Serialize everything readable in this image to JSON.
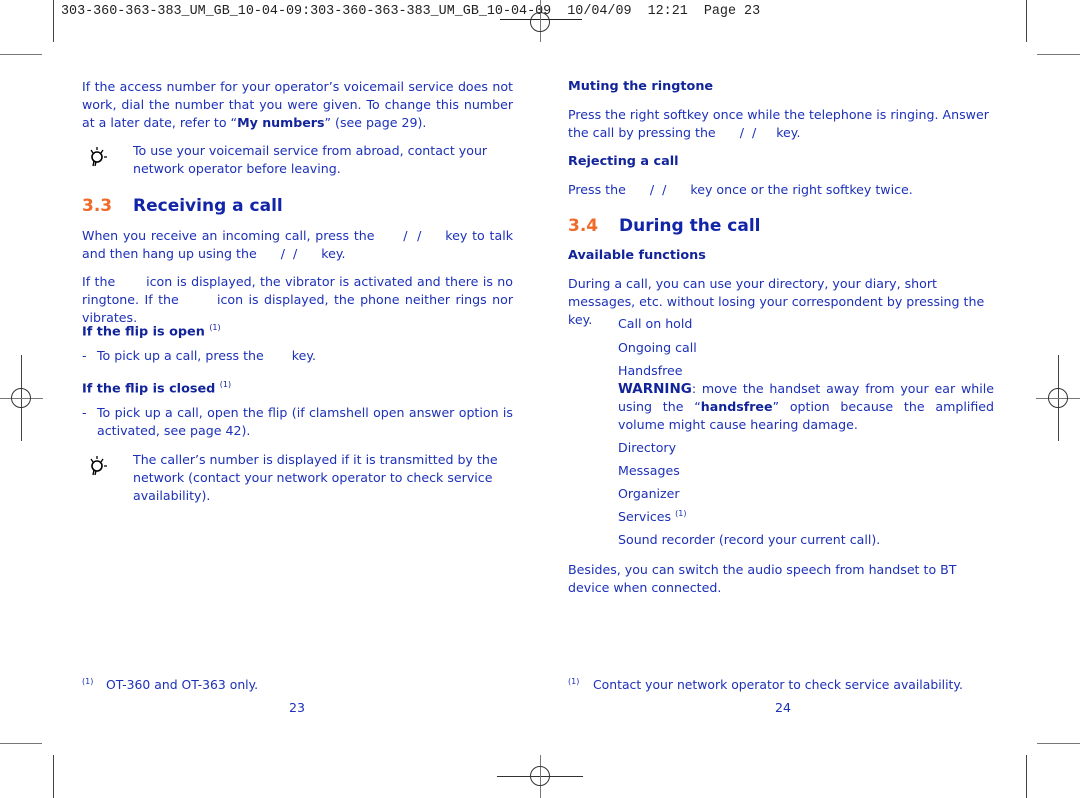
{
  "print_header": {
    "text": "303-360-363-383_UM_GB_10-04-09:303-360-363-383_UM_GB_10-04-09  10/04/09  12:21  Page 23"
  },
  "left_page": {
    "intro": {
      "part1": "If the access number for your operator’s voicemail service does not work, dial the number that you were given. To change this number at a later date, refer to “",
      "bold": "My numbers",
      "part2": "” (see page 29)."
    },
    "tip1": "To use your voicemail service from abroad, contact your network operator before leaving.",
    "section": {
      "number": "3.3",
      "title": "Receiving a call"
    },
    "para1": "When you receive an incoming call, press the      /  /     key to talk and then hang up using the      /  /      key.",
    "para2": "If the       icon is displayed, the vibrator is activated and there is no ringtone. If the       icon is displayed, the phone neither rings nor vibrates.",
    "flip_open": {
      "heading": "If the flip is open",
      "sup": "(1)",
      "bullet": "To pick up a call, press the       key."
    },
    "flip_closed": {
      "heading": "If the flip is closed",
      "sup": "(1)",
      "bullet": "To pick up a call, open the flip (if clamshell open answer option is activated, see page 42)."
    },
    "tip2": "The caller’s number is displayed if it is transmitted by the network (contact your network operator to check service availability).",
    "footnote": {
      "mark": "(1)",
      "text": "OT-360 and OT-363 only."
    },
    "page_number": "23"
  },
  "right_page": {
    "muting": {
      "heading": "Muting the ringtone",
      "text": "Press the right softkey once while the telephone is ringing. Answer the call by pressing the      /  /     key."
    },
    "rejecting": {
      "heading": "Rejecting a call",
      "text": "Press the      /  /      key once or the right softkey twice."
    },
    "section": {
      "number": "3.4",
      "title": "During the call"
    },
    "available": {
      "heading": "Available functions",
      "text": "During a call, you can use your directory, your diary, short messages, etc. without losing your correspondent by pressing the        key."
    },
    "functions": [
      "Call on hold",
      "Ongoing call",
      "Handsfree",
      "Directory",
      "Messages",
      "Organizer",
      "Services",
      "Sound recorder (record your current call)."
    ],
    "services_sup": "(1)",
    "warning": {
      "label": "WARNING",
      "part1": ": move the handset away from your ear while using the “",
      "bold": "handsfree",
      "part2": "” option because the amplified volume might cause hearing damage."
    },
    "besides": "Besides, you can switch the audio speech from handset to BT device when connected.",
    "footnote": {
      "mark": "(1)",
      "text": "Contact your network operator to check service availability."
    },
    "page_number": "24"
  },
  "colors": {
    "text": "#1c30b8",
    "section_number": "#f06a2a",
    "heading": "#1224a8"
  }
}
